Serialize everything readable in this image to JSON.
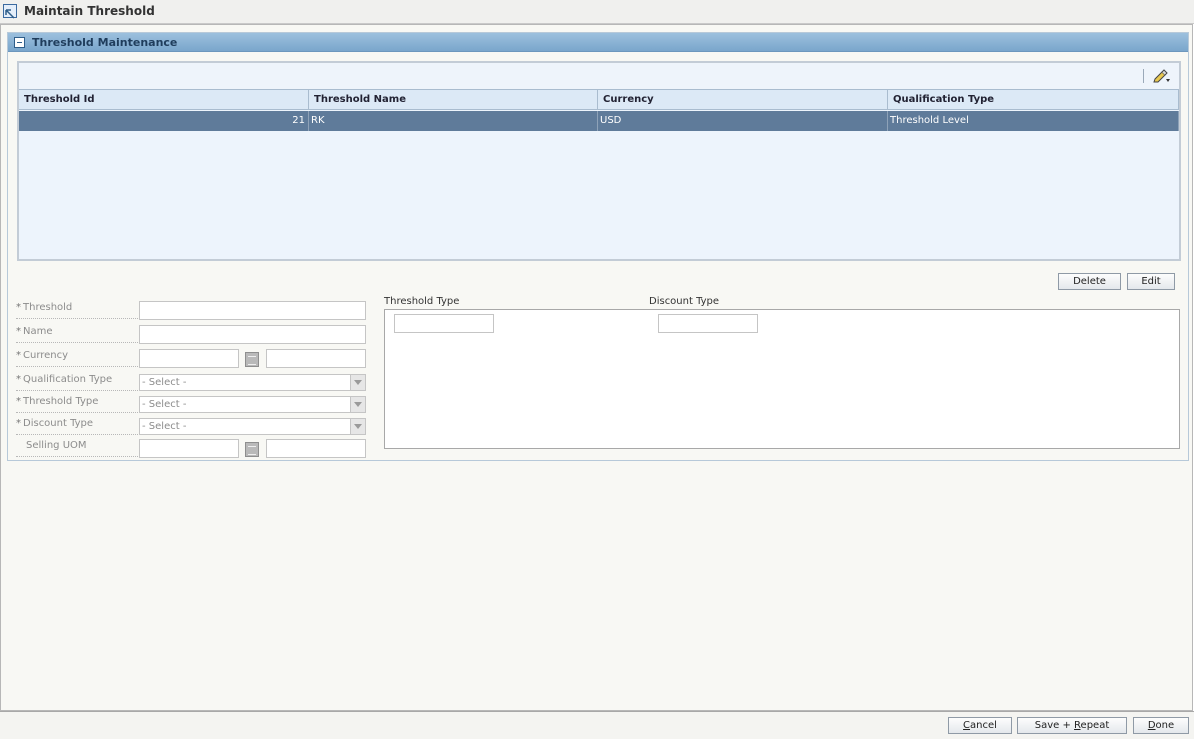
{
  "window": {
    "title": "Maintain Threshold"
  },
  "section": {
    "title": "Threshold Maintenance"
  },
  "table": {
    "columns": [
      "Threshold Id",
      "Threshold Name",
      "Currency",
      "Qualification Type"
    ],
    "rows": [
      {
        "threshold_id": "21",
        "threshold_name": "RK",
        "currency": "USD",
        "qualification_type": "Threshold Level"
      }
    ],
    "actions": {
      "delete": "Delete",
      "edit": "Edit"
    }
  },
  "form": {
    "threshold": {
      "label": "Threshold",
      "required_mark": "*",
      "value": ""
    },
    "name": {
      "label": "Name",
      "required_mark": "*",
      "value": ""
    },
    "currency": {
      "label": "Currency",
      "required_mark": "*",
      "code": "",
      "description": ""
    },
    "qualification_type": {
      "label": "Qualification Type",
      "required_mark": "*",
      "selected": "- Select -"
    },
    "threshold_type": {
      "label": "Threshold Type",
      "required_mark": "*",
      "selected": "- Select -"
    },
    "discount_type": {
      "label": "Discount Type",
      "required_mark": "*",
      "selected": "- Select -"
    },
    "selling_uom": {
      "label": "Selling UOM",
      "code": "",
      "description": ""
    }
  },
  "right_panel": {
    "threshold_type_label": "Threshold Type",
    "discount_type_label": "Discount Type",
    "threshold_type_value": "",
    "discount_type_value": ""
  },
  "footer": {
    "cancel": {
      "prefix": "",
      "mnemonic": "C",
      "suffix": "ancel"
    },
    "save_repeat": {
      "prefix": "Save + ",
      "mnemonic": "R",
      "suffix": "epeat"
    },
    "done": {
      "prefix": "",
      "mnemonic": "D",
      "suffix": "one"
    }
  },
  "icons": {
    "window": "arrow-icon",
    "collapse": "collapse-icon",
    "edit": "pencil-icon",
    "lookup": "lookup-icon"
  },
  "colors": {
    "selected_row": "#5f7b9a",
    "section_header": "#7aa6cc"
  }
}
